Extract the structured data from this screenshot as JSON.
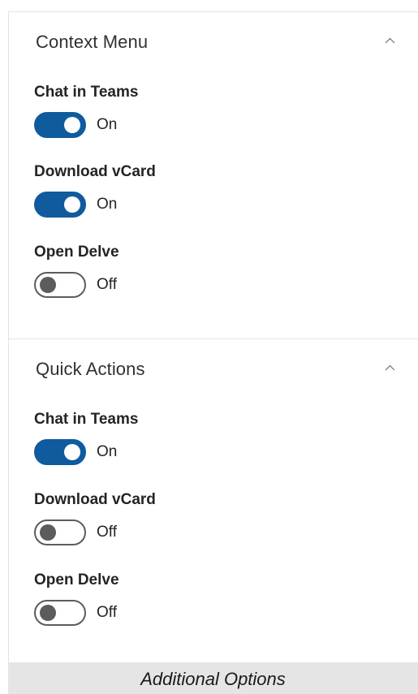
{
  "sections": [
    {
      "title": "Context Menu",
      "settings": [
        {
          "label": "Chat in Teams",
          "enabled": true,
          "state_text": "On"
        },
        {
          "label": "Download vCard",
          "enabled": true,
          "state_text": "On"
        },
        {
          "label": "Open Delve",
          "enabled": false,
          "state_text": "Off"
        }
      ]
    },
    {
      "title": "Quick Actions",
      "settings": [
        {
          "label": "Chat in Teams",
          "enabled": true,
          "state_text": "On"
        },
        {
          "label": "Download vCard",
          "enabled": false,
          "state_text": "Off"
        },
        {
          "label": "Open Delve",
          "enabled": false,
          "state_text": "Off"
        }
      ]
    }
  ],
  "icons": {
    "section_toggle": "chevron-up-icon"
  },
  "colors": {
    "toggle_on": "#0f5b9e",
    "toggle_off_border": "#5c5c5c",
    "caption_bar": "#e5e5e5"
  },
  "caption": "Additional Options"
}
